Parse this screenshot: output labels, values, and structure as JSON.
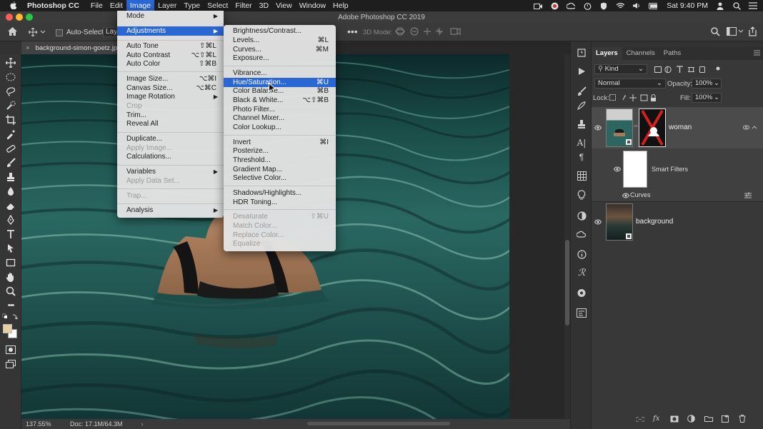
{
  "menubar": {
    "app_name": "Photoshop CC",
    "menus": [
      "File",
      "Edit",
      "Image",
      "Layer",
      "Type",
      "Select",
      "Filter",
      "3D",
      "View",
      "Window",
      "Help"
    ],
    "active_menu": "Image",
    "clock": "Sat 9:40 PM"
  },
  "window": {
    "title": "Adobe Photoshop CC 2019"
  },
  "options": {
    "auto_select_label": "Auto-Select:",
    "auto_select_value": "Laye",
    "mode_3d_label": "3D Mode:"
  },
  "document": {
    "tab_name": "background-simon-goetz.jp",
    "zoom": "137.55%",
    "doc_info": "Doc: 17.1M/64.3M"
  },
  "image_menu": {
    "items": [
      {
        "label": "Mode",
        "submenu": true
      },
      {
        "label": "Adjustments",
        "submenu": true,
        "highlighted": true
      },
      {
        "label": "Auto Tone",
        "shortcut": "⇧⌘L"
      },
      {
        "label": "Auto Contrast",
        "shortcut": "⌥⇧⌘L"
      },
      {
        "label": "Auto Color",
        "shortcut": "⇧⌘B"
      },
      {
        "label": "Image Size...",
        "shortcut": "⌥⌘I"
      },
      {
        "label": "Canvas Size...",
        "shortcut": "⌥⌘C"
      },
      {
        "label": "Image Rotation",
        "submenu": true
      },
      {
        "label": "Crop",
        "disabled": true
      },
      {
        "label": "Trim..."
      },
      {
        "label": "Reveal All"
      },
      {
        "label": "Duplicate..."
      },
      {
        "label": "Apply Image...",
        "disabled": true
      },
      {
        "label": "Calculations..."
      },
      {
        "label": "Variables",
        "submenu": true
      },
      {
        "label": "Apply Data Set...",
        "disabled": true
      },
      {
        "label": "Trap...",
        "disabled": true
      },
      {
        "label": "Analysis",
        "submenu": true
      }
    ]
  },
  "adjustments_menu": {
    "items": [
      {
        "label": "Brightness/Contrast..."
      },
      {
        "label": "Levels...",
        "shortcut": "⌘L"
      },
      {
        "label": "Curves...",
        "shortcut": "⌘M"
      },
      {
        "label": "Exposure..."
      },
      {
        "label": "Vibrance..."
      },
      {
        "label": "Hue/Saturation...",
        "shortcut": "⌘U",
        "highlighted": true
      },
      {
        "label": "Color Balance...",
        "shortcut": "⌘B"
      },
      {
        "label": "Black & White...",
        "shortcut": "⌥⇧⌘B"
      },
      {
        "label": "Photo Filter..."
      },
      {
        "label": "Channel Mixer..."
      },
      {
        "label": "Color Lookup..."
      },
      {
        "label": "Invert",
        "shortcut": "⌘I"
      },
      {
        "label": "Posterize..."
      },
      {
        "label": "Threshold..."
      },
      {
        "label": "Gradient Map..."
      },
      {
        "label": "Selective Color..."
      },
      {
        "label": "Shadows/Highlights..."
      },
      {
        "label": "HDR Toning..."
      },
      {
        "label": "Desaturate",
        "shortcut": "⇧⌘U",
        "disabled": true
      },
      {
        "label": "Match Color...",
        "disabled": true
      },
      {
        "label": "Replace Color...",
        "disabled": true
      },
      {
        "label": "Equalize",
        "disabled": true
      }
    ]
  },
  "layers_panel": {
    "tabs": [
      "Layers",
      "Channels",
      "Paths"
    ],
    "active_tab": "Layers",
    "filter_kind": "Kind",
    "blend_mode": "Normal",
    "opacity_label": "Opacity:",
    "opacity_value": "100%",
    "lock_label": "Lock:",
    "fill_label": "Fill:",
    "fill_value": "100%",
    "layers": [
      {
        "name": "woman"
      },
      {
        "name": "Smart Filters"
      },
      {
        "name": "Curves"
      },
      {
        "name": "background"
      }
    ]
  },
  "colors": {
    "menu_highlight": "#2a67d4",
    "foreground_swatch": "#e8cfa3",
    "background_swatch": "#ffffff"
  }
}
